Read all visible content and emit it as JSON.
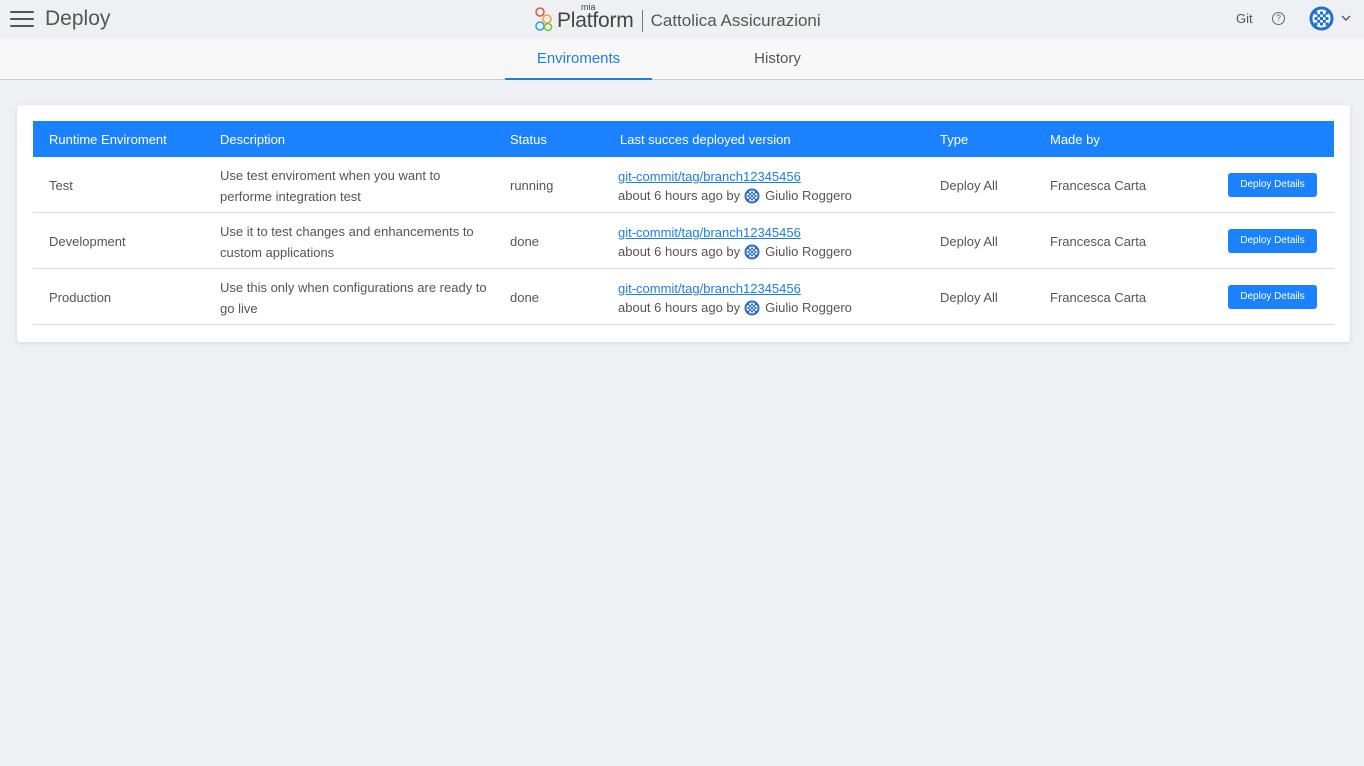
{
  "header": {
    "page_title": "Deploy",
    "brand_small": "mia",
    "brand_name": "Platform",
    "company": "Cattolica Assicurazioni",
    "git_label": "Git",
    "help_glyph": "?"
  },
  "tabs": [
    {
      "label": "Enviroments",
      "active": true
    },
    {
      "label": "History",
      "active": false
    }
  ],
  "table": {
    "columns": [
      "Runtime Enviroment",
      "Description",
      "Status",
      "Last succes deployed version",
      "Type",
      "Made by"
    ],
    "rows": [
      {
        "env": "Test",
        "desc": "Use test enviroment when you want to performe integration test",
        "status": "running",
        "version": "git-commit/tag/branch12345456",
        "when": "about 6 hours ago by",
        "author": "Giulio Roggero",
        "type": "Deploy All",
        "made_by": "Francesca Carta",
        "button": "Deploy Details"
      },
      {
        "env": "Development",
        "desc": "Use it to test changes and enhancements to custom applications",
        "status": "done",
        "version": "git-commit/tag/branch12345456",
        "when": "about 6 hours ago by",
        "author": "Giulio Roggero",
        "type": "Deploy All",
        "made_by": "Francesca Carta",
        "button": "Deploy Details"
      },
      {
        "env": "Production",
        "desc": "Use this only when configurations are ready to go live",
        "status": "done",
        "version": "git-commit/tag/branch12345456",
        "when": "about 6 hours ago by",
        "author": "Giulio Roggero",
        "type": "Deploy All",
        "made_by": "Francesca Carta",
        "button": "Deploy Details"
      }
    ]
  },
  "colors": {
    "accent": "#1b82ff",
    "link": "#1b7fe3",
    "background": "#eff0f4"
  },
  "icons": [
    "menu-icon",
    "mia-platform-logo-icon",
    "help-icon",
    "user-avatar-icon",
    "chevron-down-icon"
  ]
}
